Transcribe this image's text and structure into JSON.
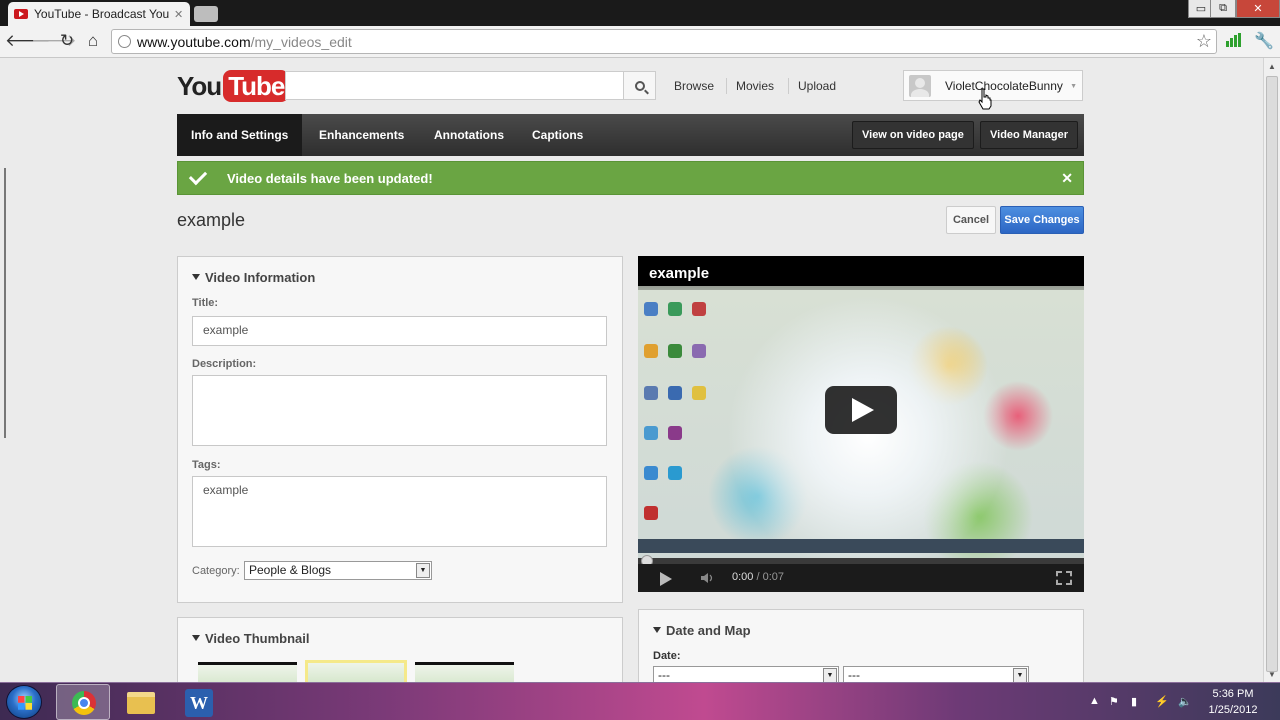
{
  "browser": {
    "tab_title": "YouTube - Broadcast Yours",
    "tab_close": "✕",
    "url_host": "www.youtube.com",
    "url_path": "/my_videos_edit",
    "window_controls": [
      "▭",
      "⧉",
      "✕"
    ]
  },
  "header": {
    "logo_you": "You",
    "logo_tube": "Tube",
    "search_value": "",
    "nav": [
      "Browse",
      "Movies",
      "Upload"
    ],
    "username": "VioletChocolateBunny"
  },
  "edit_tabs": {
    "items": [
      "Info and Settings",
      "Enhancements",
      "Annotations",
      "Captions"
    ],
    "active": "Info and Settings",
    "view_on_page": "View on video page",
    "video_manager": "Video Manager"
  },
  "alert": {
    "message": "Video details have been updated!",
    "close": "✕"
  },
  "video": {
    "title": "example",
    "cancel_label": "Cancel",
    "save_label": "Save Changes"
  },
  "video_info": {
    "heading": "Video Information",
    "title_label": "Title:",
    "title_value": "example",
    "description_label": "Description:",
    "description_value": "",
    "tags_label": "Tags:",
    "tags_value": "example",
    "category_label": "Category:",
    "category_value": "People & Blogs"
  },
  "thumbnail": {
    "heading": "Video Thumbnail"
  },
  "player": {
    "title": "example",
    "time_current": "0:00",
    "time_separator": " / ",
    "time_total": "0:07"
  },
  "date_map": {
    "heading": "Date and Map",
    "date_label": "Date:",
    "month_value": "---",
    "day_value": "---"
  },
  "taskbar": {
    "time": "5:36 PM",
    "date": "1/25/2012"
  },
  "colors": {
    "accent_red": "#d72b2b",
    "alert_green": "#6aa543",
    "save_blue": "#2c66c4"
  }
}
